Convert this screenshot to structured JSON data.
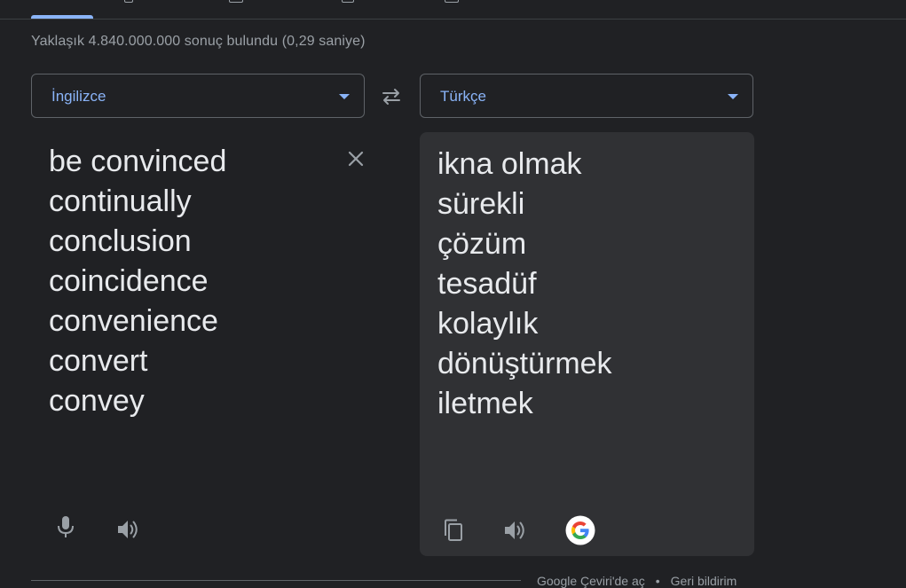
{
  "results": {
    "stats": "Yaklaşık 4.840.000.000 sonuç bulundu (0,29 saniye)"
  },
  "translator": {
    "source_language": "İngilizce",
    "target_language": "Türkçe",
    "source_lines": [
      "be convinced",
      "continually",
      "conclusion",
      "coincidence",
      "convenience",
      "convert",
      "convey"
    ],
    "target_lines": [
      "ikna olmak",
      "sürekli",
      "çözüm",
      "tesadüf",
      "kolaylık",
      "dönüştürmek",
      "iletmek"
    ]
  },
  "icons": {
    "swap": "swap-languages-icon",
    "clear": "close-icon",
    "mic": "microphone-icon",
    "speak_source": "speaker-icon",
    "copy": "copy-icon",
    "speak_target": "speaker-icon",
    "google": "google-logo-icon"
  },
  "footer": {
    "open_in_translate": "Google Çeviri'de aç",
    "feedback": "Geri bildirim"
  },
  "colors": {
    "background": "#202124",
    "panel": "#303134",
    "accent": "#8ab4f8",
    "text": "#e8eaed",
    "muted": "#9aa0a6"
  }
}
